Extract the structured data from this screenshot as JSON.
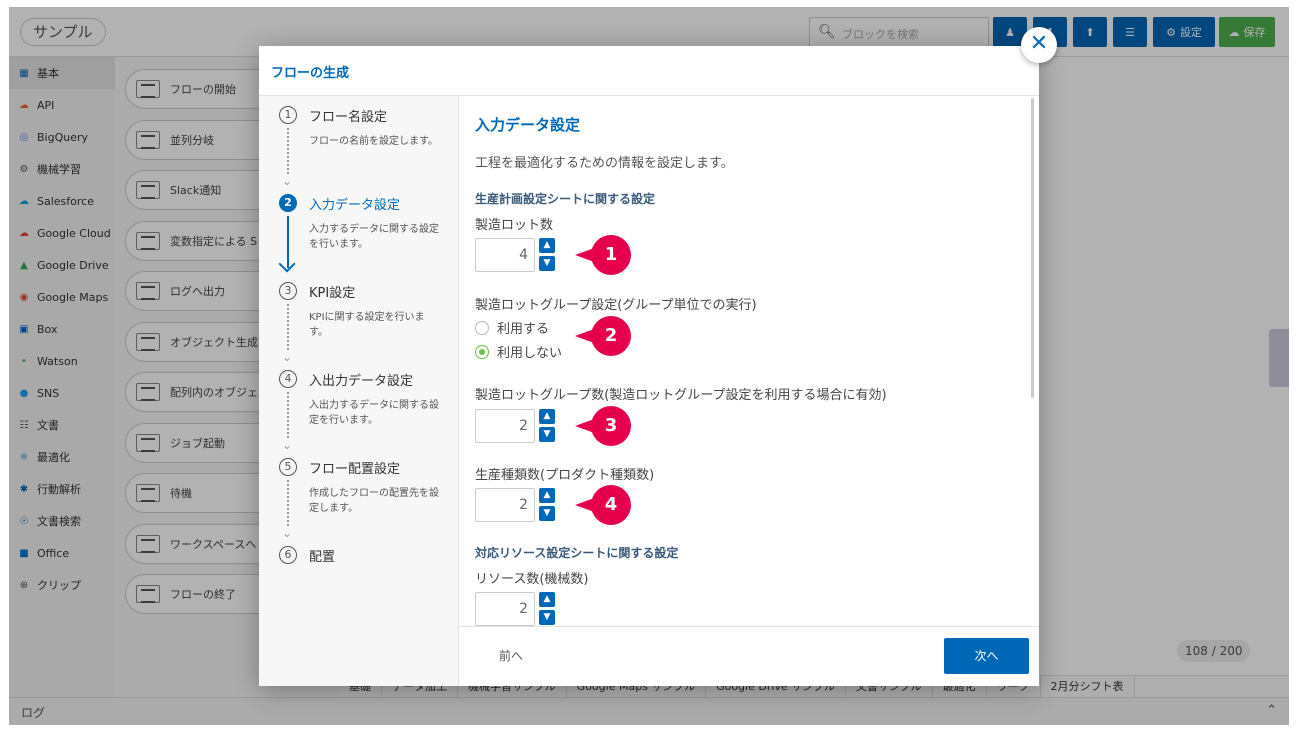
{
  "app": {
    "title": "サンプル"
  },
  "toolbar": {
    "search_placeholder": "ブロックを検索",
    "settings_label": "設定",
    "save_label": "保存"
  },
  "sidebar": {
    "items": [
      {
        "label": "基本",
        "icon": "block-icon"
      },
      {
        "label": "API",
        "icon": "api-icon"
      },
      {
        "label": "BigQuery",
        "icon": "bigquery-icon"
      },
      {
        "label": "機械学習",
        "icon": "ml-icon"
      },
      {
        "label": "Salesforce",
        "icon": "salesforce-icon"
      },
      {
        "label": "Google Cloud",
        "icon": "google-cloud-icon"
      },
      {
        "label": "Google Drive",
        "icon": "google-drive-icon"
      },
      {
        "label": "Google Maps",
        "icon": "google-maps-icon"
      },
      {
        "label": "Box",
        "icon": "box-icon"
      },
      {
        "label": "Watson",
        "icon": "watson-icon"
      },
      {
        "label": "SNS",
        "icon": "sns-icon"
      },
      {
        "label": "文書",
        "icon": "document-icon"
      },
      {
        "label": "最適化",
        "icon": "optimization-icon"
      },
      {
        "label": "行動解析",
        "icon": "behavior-icon"
      },
      {
        "label": "文書検索",
        "icon": "doc-search-icon"
      },
      {
        "label": "Office",
        "icon": "office-icon"
      },
      {
        "label": "クリップ",
        "icon": "clip-icon"
      }
    ]
  },
  "blocks": [
    "フローの開始",
    "並列分岐",
    "Slack通知",
    "変数指定による S",
    "ログへ出力",
    "オブジェクト生成",
    "配列内のオブジェ 変換",
    "ジョブ起動",
    "待機",
    "ワークスペースへ ジを送信",
    "フローの終了"
  ],
  "canvas": {
    "counter": "108 / 200"
  },
  "sheet_tabs": [
    "基礎",
    "データ加工",
    "機械学習サンプル",
    "Google Maps サンプル",
    "Google Drive サンプル",
    "文書サンプル",
    "最適化",
    "ワーク",
    "2月分シフト表"
  ],
  "logbar": {
    "label": "ログ"
  },
  "modal": {
    "title": "フローの生成",
    "steps": [
      {
        "num": "1",
        "title": "フロー名設定",
        "desc": "フローの名前を設定します。"
      },
      {
        "num": "2",
        "title": "入力データ設定",
        "desc": "入力するデータに関する設定を行います。"
      },
      {
        "num": "3",
        "title": "KPI設定",
        "desc": "KPIに関する設定を行います。"
      },
      {
        "num": "4",
        "title": "入出力データ設定",
        "desc": "入出力するデータに関する設定を行います。"
      },
      {
        "num": "5",
        "title": "フロー配置設定",
        "desc": "作成したフローの配置先を設定します。"
      },
      {
        "num": "6",
        "title": "配置",
        "desc": ""
      }
    ],
    "active_step": 2,
    "content": {
      "section_title": "入力データ設定",
      "lead": "工程を最適化するための情報を設定します。",
      "group1_title": "生産計画設定シートに関する設定",
      "lot_count_label": "製造ロット数",
      "lot_count_value": "4",
      "lot_group_setting_label": "製造ロットグループ設定(グループ単位での実行)",
      "radio_use": "利用する",
      "radio_not_use": "利用しない",
      "lot_group_count_label": "製造ロットグループ数(製造ロットグループ設定を利用する場合に有効)",
      "lot_group_count_value": "2",
      "product_types_label": "生産種類数(プロダクト種類数)",
      "product_types_value": "2",
      "group2_title": "対応リソース設定シートに関する設定",
      "resource_count_label": "リソース数(機械数)",
      "resource_count_value": "2"
    },
    "badges": [
      "1",
      "2",
      "3",
      "4"
    ],
    "prev_label": "前へ",
    "next_label": "次へ"
  },
  "colors": {
    "primary": "#0068b7",
    "accent": "#e6004c",
    "save": "#4caf50"
  }
}
